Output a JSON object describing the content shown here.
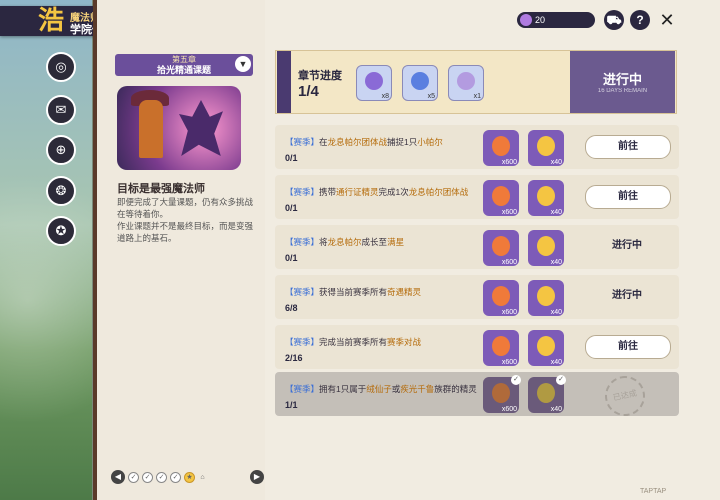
{
  "logo": {
    "mark": "浩",
    "line1": "魔法师手册",
    "line2": "学院作业"
  },
  "sidebar": {
    "items": [
      {
        "icon": "compass-icon",
        "glyph": "◎"
      },
      {
        "icon": "bag-icon",
        "glyph": "✉"
      },
      {
        "icon": "globe-icon",
        "glyph": "⊕"
      },
      {
        "icon": "map-icon",
        "glyph": "❂"
      },
      {
        "icon": "badge-icon",
        "glyph": "✪"
      }
    ]
  },
  "chapter": {
    "number": "第五章",
    "title": "拾光精通课题"
  },
  "goal": {
    "title": "目标是最强魔法师",
    "desc1": "即便完成了大量课题，仍有众多挑战在等待着你。",
    "desc2": "作业课题并不是最终目标，而是变强道路上的基石。"
  },
  "top": {
    "gems": "20"
  },
  "progress": {
    "label": "章节进度",
    "value": "1/4",
    "vertical_tag": "",
    "rewards": [
      {
        "count": "x8",
        "color": "#8a6ad6"
      },
      {
        "count": "x5",
        "color": "#5a7fe0"
      },
      {
        "count": "x1",
        "color": "#b39be0"
      }
    ],
    "status": "进行中",
    "status_sub": "16 DAYS REMAIN"
  },
  "tasks": [
    {
      "tag": "【赛季】",
      "pre": "在",
      "hl1": "龙息帕尔团体战",
      "mid": "捕捉1只",
      "hl2": "小帕尔",
      "post": "",
      "value": "0/1",
      "r1": "x600",
      "r2": "x40",
      "state": "go",
      "action": "前往"
    },
    {
      "tag": "【赛季】",
      "pre": "携带",
      "hl1": "通行证精灵",
      "mid": "完成1次",
      "hl2": "龙息帕尔团体战",
      "post": "",
      "value": "0/1",
      "r1": "x600",
      "r2": "x40",
      "state": "go",
      "action": "前往"
    },
    {
      "tag": "【赛季】",
      "pre": "将",
      "hl1": "龙息帕尔",
      "mid": "成长至",
      "hl2": "满星",
      "post": "",
      "value": "0/1",
      "r1": "x600",
      "r2": "x40",
      "state": "ing",
      "action": "进行中"
    },
    {
      "tag": "【赛季】",
      "pre": "获得当前赛季所有",
      "hl1": "奇遇精灵",
      "mid": "",
      "hl2": "",
      "post": "",
      "value": "6/8",
      "r1": "x600",
      "r2": "x40",
      "state": "ing",
      "action": "进行中"
    },
    {
      "tag": "【赛季】",
      "pre": "完成当前赛季所有",
      "hl1": "赛季对战",
      "mid": "",
      "hl2": "",
      "post": "",
      "value": "2/16",
      "r1": "x600",
      "r2": "x40",
      "state": "go",
      "action": "前往"
    },
    {
      "tag": "【赛季】",
      "pre": "拥有1只属于",
      "hl1": "绒仙子",
      "mid": "或",
      "hl2": "疾光千鲁",
      "post": "族群的精灵",
      "value": "1/1",
      "r1": "x600",
      "r2": "x40",
      "state": "done",
      "action": "已达成"
    }
  ],
  "pager": {
    "prev": "◀",
    "next": "▶"
  },
  "colors": {
    "accent": "#6b5a8f",
    "dark": "#2b2740",
    "highlight": "#b56c0c",
    "season": "#3b6fd6"
  },
  "watermark": "TAPTAP"
}
